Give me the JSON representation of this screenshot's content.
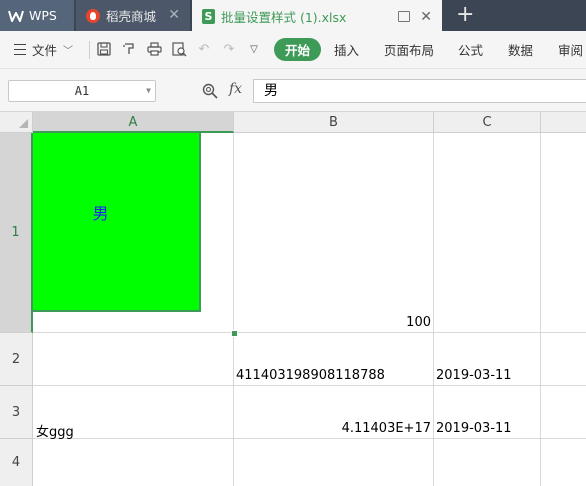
{
  "tabs": {
    "wps": {
      "label": "WPS"
    },
    "shop": {
      "label": "稻壳商城",
      "close": "✕"
    },
    "file": {
      "label": "批量设置样式 (1).xlsx",
      "close": "✕"
    },
    "add": "+"
  },
  "ribbon": {
    "file_menu": "文件",
    "items": [
      "开始",
      "插入",
      "页面布局",
      "公式",
      "数据",
      "审阅"
    ]
  },
  "formula_bar": {
    "name_box": "A1",
    "fx": "fx",
    "value": "男"
  },
  "sheet": {
    "columns": [
      "A",
      "B",
      "C"
    ],
    "rows": [
      "1",
      "2",
      "3",
      "4"
    ],
    "cells": {
      "A1": "男",
      "B1": "100",
      "B2": "411403198908118788",
      "C2": "2019-03-11",
      "A3": "女ggg",
      "B3": "4.11403E+17",
      "C3": "2019-03-11"
    },
    "colors": {
      "a1_fill": "#00ff00",
      "a1_text": "#1f1fff",
      "accent": "#3d9a57"
    }
  }
}
